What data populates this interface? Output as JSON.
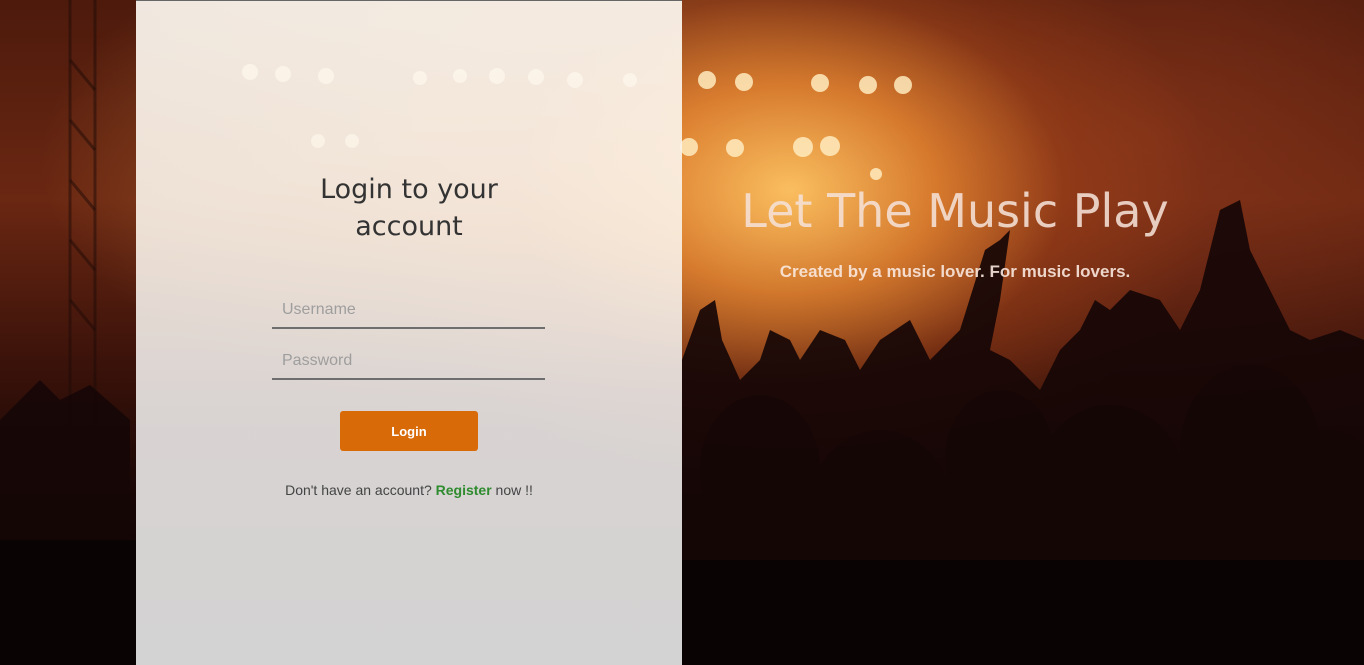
{
  "login": {
    "title_line1": "Login to your",
    "title_line2": "account",
    "username_placeholder": "Username",
    "password_placeholder": "Password",
    "button_label": "Login",
    "register_prefix": "Don't have an account? ",
    "register_link": "Register",
    "register_suffix": " now !!"
  },
  "hero": {
    "title": "Let The Music Play",
    "subtitle": "Created by a music lover. For music lovers."
  },
  "colors": {
    "accent": "#d96a08",
    "link": "#2e8b2e",
    "text": "#333333"
  }
}
